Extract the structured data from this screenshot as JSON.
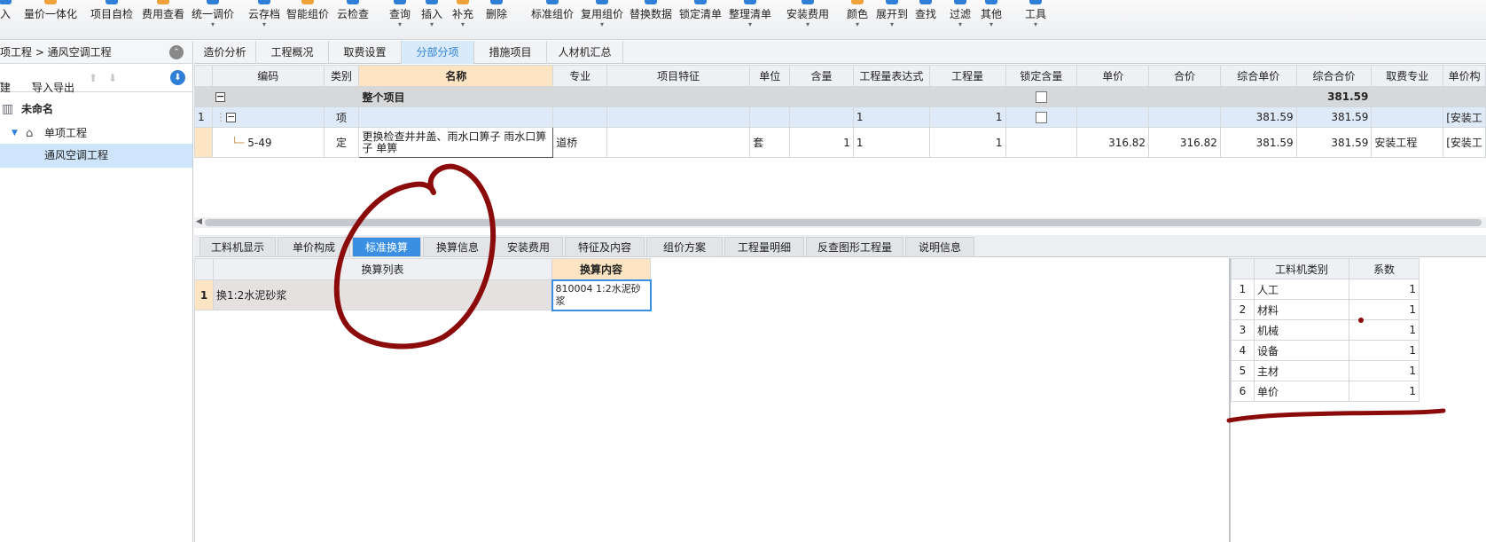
{
  "toolbar": {
    "items": [
      {
        "label": "入",
        "dropdown": false
      },
      {
        "label": "量价一体化",
        "dropdown": false
      },
      {
        "label": "项目自检",
        "dropdown": false
      },
      {
        "label": "费用查看",
        "dropdown": false
      },
      {
        "label": "统一调价",
        "dropdown": true
      },
      {
        "label": "云存档",
        "dropdown": true
      },
      {
        "label": "智能组价",
        "dropdown": false
      },
      {
        "label": "云检查",
        "dropdown": false
      },
      {
        "label": "查询",
        "dropdown": true
      },
      {
        "label": "插入",
        "dropdown": true
      },
      {
        "label": "补充",
        "dropdown": true
      },
      {
        "label": "删除",
        "dropdown": false
      },
      {
        "label": "标准组价",
        "dropdown": false
      },
      {
        "label": "复用组价",
        "dropdown": true
      },
      {
        "label": "替换数据",
        "dropdown": false
      },
      {
        "label": "锁定清单",
        "dropdown": false
      },
      {
        "label": "整理清单",
        "dropdown": true
      },
      {
        "label": "安装费用",
        "dropdown": true
      },
      {
        "label": "颜色",
        "dropdown": true
      },
      {
        "label": "展开到",
        "dropdown": true
      },
      {
        "label": "查找",
        "dropdown": false
      },
      {
        "label": "过滤",
        "dropdown": true
      },
      {
        "label": "其他",
        "dropdown": true
      },
      {
        "label": "工具",
        "dropdown": true
      }
    ]
  },
  "left": {
    "breadcrumb": "项工程 > 通风空调工程",
    "new_label": "建",
    "import_export_label": "导入导出",
    "tree": [
      {
        "label": "未命名"
      },
      {
        "label": "单项工程"
      },
      {
        "label": "通风空调工程"
      }
    ]
  },
  "tabs": [
    "造价分析",
    "工程概况",
    "取费设置",
    "分部分项",
    "措施项目",
    "人材机汇总"
  ],
  "grid": {
    "headers": [
      "编码",
      "类别",
      "名称",
      "专业",
      "项目特征",
      "单位",
      "含量",
      "工程量表达式",
      "工程量",
      "锁定含量",
      "单价",
      "合价",
      "综合单价",
      "综合合价",
      "取费专业",
      "单价构"
    ],
    "total_row": {
      "name": "整个项目",
      "total": "381.59"
    },
    "section_row": {
      "num": "1",
      "type": "项",
      "expr": "1",
      "qty": "1",
      "unit_price": "381.59",
      "total": "381.59",
      "fee": "[安装工"
    },
    "item_row": {
      "code": "5-49",
      "type": "定",
      "name": "更换检查井井盖、雨水口箅子 雨水口箅子 单箅",
      "major": "道桥",
      "unit": "套",
      "content": "1",
      "expr": "1",
      "qty": "1",
      "price": "316.82",
      "amount": "316.82",
      "unit_price": "381.59",
      "total": "381.59",
      "fee_major": "安装工程",
      "fee": "[安装工"
    }
  },
  "bottom_tabs": [
    "工料机显示",
    "单价构成",
    "标准换算",
    "换算信息",
    "安装费用",
    "特征及内容",
    "组价方案",
    "工程量明细",
    "反查图形工程量",
    "说明信息"
  ],
  "sub_grid": {
    "headers": [
      "换算列表",
      "换算内容"
    ],
    "rows": [
      {
        "num": "1",
        "name": "换1:2水泥砂浆",
        "content": "810004  1:2水泥砂浆"
      }
    ]
  },
  "right_grid": {
    "headers": [
      "工料机类别",
      "系数"
    ],
    "rows": [
      {
        "num": "1",
        "name": "人工",
        "value": "1"
      },
      {
        "num": "2",
        "name": "材料",
        "value": "1"
      },
      {
        "num": "3",
        "name": "机械",
        "value": "1"
      },
      {
        "num": "4",
        "name": "设备",
        "value": "1"
      },
      {
        "num": "5",
        "name": "主材",
        "value": "1"
      },
      {
        "num": "6",
        "name": "单价",
        "value": "1"
      }
    ]
  },
  "colors": {
    "accent": "#3b8fe3",
    "annotation": "#8b0a0a",
    "header_highlight": "#fde4c2"
  }
}
